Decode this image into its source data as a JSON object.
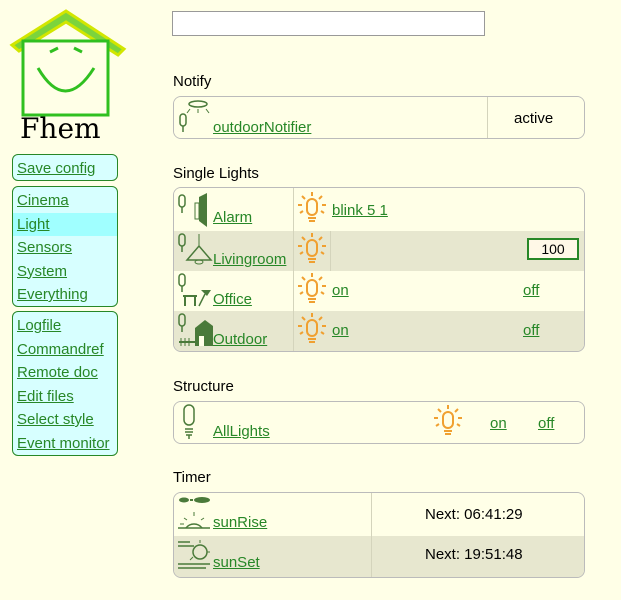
{
  "logo": {
    "text": "Fhem"
  },
  "search": {
    "value": "",
    "placeholder": ""
  },
  "menu1": {
    "items": [
      {
        "label": "Save config"
      }
    ]
  },
  "menu2": {
    "items": [
      {
        "label": "Cinema"
      },
      {
        "label": "Light",
        "selected": true
      },
      {
        "label": "Sensors"
      },
      {
        "label": "System"
      },
      {
        "label": "Everything"
      }
    ]
  },
  "menu3": {
    "items": [
      {
        "label": "Logfile"
      },
      {
        "label": "Commandref"
      },
      {
        "label": "Remote doc"
      },
      {
        "label": "Edit files"
      },
      {
        "label": "Select style"
      },
      {
        "label": "Event monitor"
      }
    ]
  },
  "notify": {
    "title": "Notify",
    "rows": [
      {
        "name": "outdoorNotifier",
        "state": "active",
        "icon": "notifier-icon"
      }
    ]
  },
  "lights": {
    "title": "Single Lights",
    "rows": [
      {
        "name": "Alarm",
        "state": "blink 5 1",
        "icon": "alarm-icon"
      },
      {
        "name": "Livingroom",
        "value": "100",
        "icon": "ceiling-lamp-icon"
      },
      {
        "name": "Office",
        "on": "on",
        "off": "off",
        "icon": "desk-lamp-icon"
      },
      {
        "name": "Outdoor",
        "on": "on",
        "off": "off",
        "icon": "outdoor-house-icon"
      }
    ]
  },
  "structure": {
    "title": "Structure",
    "rows": [
      {
        "name": "AllLights",
        "on": "on",
        "off": "off",
        "icon": "bulb-icon"
      }
    ]
  },
  "timer": {
    "title": "Timer",
    "rows": [
      {
        "name": "sunRise",
        "next": "Next: 06:41:29",
        "icon": "sunrise-icon"
      },
      {
        "name": "sunSet",
        "next": "Next: 19:51:48",
        "icon": "sunset-icon"
      }
    ]
  },
  "colors": {
    "link": "#278727",
    "bulb": "#f0a030",
    "menu_bg": "#d7ffff",
    "menu_sel": "#a0ffff"
  }
}
